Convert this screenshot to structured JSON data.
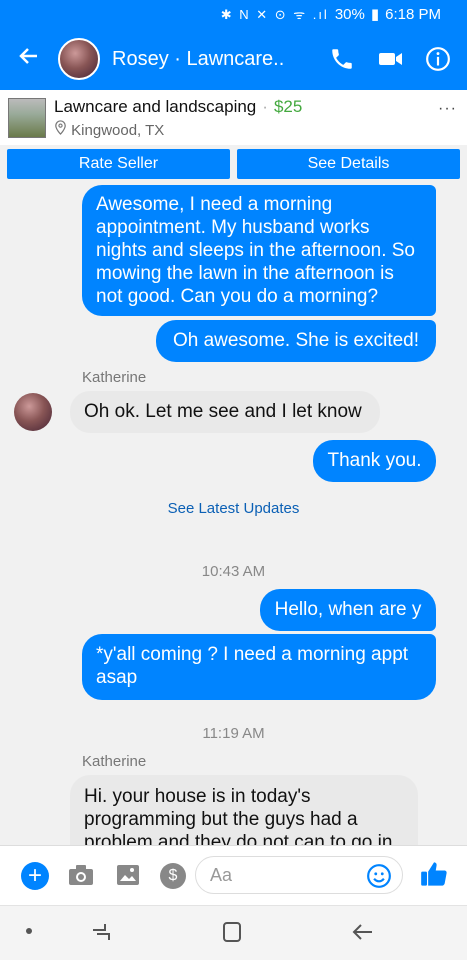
{
  "status": {
    "icons": "✱ N ✕ ⊙ ᯤ .ıl",
    "battery": "30%",
    "time": "6:18 PM"
  },
  "header": {
    "title": "Rosey · Lawncare..."
  },
  "listing": {
    "title": "Lawncare and landscaping",
    "price": "$25",
    "location": "Kingwood, TX",
    "more": "···"
  },
  "buttons": {
    "rate": "Rate Seller",
    "details": "See Details"
  },
  "messages": {
    "m1": "Awesome, I need a morning appointment. My husband works nights and sleeps in the afternoon. So mowing the lawn in the afternoon is not good. Can you do a morning?",
    "m2": "Oh awesome. She is excited!",
    "sender1": "Katherine",
    "m3": "Oh ok. Let me see and I let know",
    "m4": "Thank you.",
    "see_updates": "See Latest Updates",
    "time1": "10:43 AM",
    "m5": "Hello, when are y",
    "m6": "*y'all coming ? I need a morning appt asap",
    "time2": "11:19 AM",
    "sender2": "Katherine",
    "m7": "Hi. your house is in today's programming but the guys had a problem and they do not can to go in"
  },
  "composer": {
    "placeholder": "Aa"
  }
}
